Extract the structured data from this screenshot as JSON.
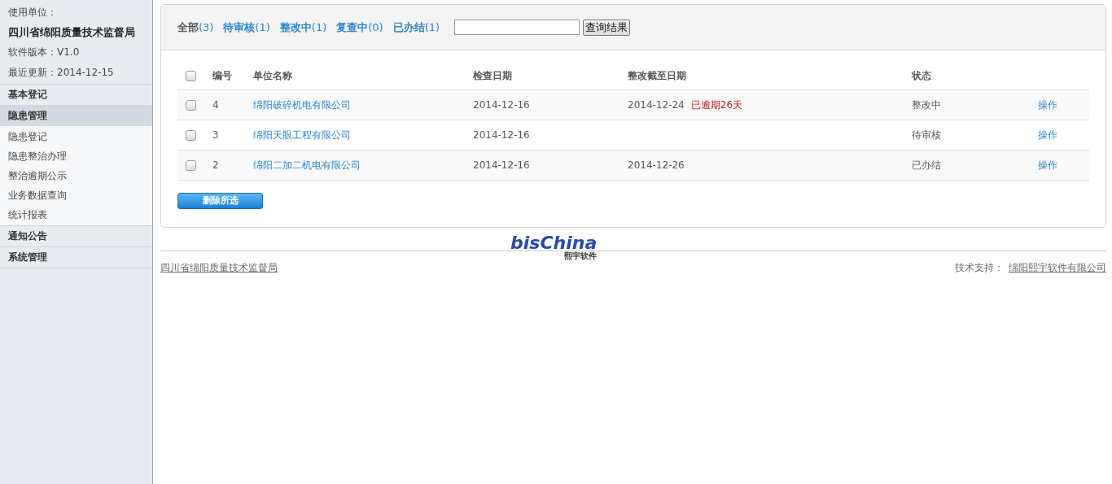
{
  "sidebar": {
    "info": [
      {
        "label": "使用单位：",
        "bold": false
      },
      {
        "label": "四川省绵阳质量技术监督局",
        "bold": true
      },
      {
        "label": "软件版本：V1.0",
        "bold": false
      },
      {
        "label": "最近更新：2014-12-15",
        "bold": false
      }
    ],
    "sections": [
      {
        "label": "基本登记",
        "expanded": false
      },
      {
        "label": "隐患管理",
        "expanded": true,
        "children": [
          {
            "label": "隐患登记"
          },
          {
            "label": "隐患整治办理"
          },
          {
            "label": "整治逾期公示"
          },
          {
            "label": "业务数据查询"
          },
          {
            "label": "统计报表"
          }
        ]
      },
      {
        "label": "通知公告",
        "expanded": false
      },
      {
        "label": "系统管理",
        "expanded": false
      }
    ]
  },
  "filters": [
    {
      "label": "全部",
      "count": "(3)",
      "selected": true
    },
    {
      "label": "待审核",
      "count": "(1)",
      "selected": false
    },
    {
      "label": "整改中",
      "count": "(1)",
      "selected": false
    },
    {
      "label": "复查中",
      "count": "(0)",
      "selected": false
    },
    {
      "label": "已办结",
      "count": "(1)",
      "selected": false
    }
  ],
  "search": {
    "button": "查询结果"
  },
  "table": {
    "all_checked": false,
    "columns": [
      "编号",
      "单位名称",
      "检查日期",
      "整改截至日期",
      "状态"
    ],
    "rows": [
      {
        "checked": false,
        "no": "4",
        "name": "绵阳破碎机电有限公司",
        "check_date": "2014-12-16",
        "deadline": "2014-12-24",
        "overdue": "已逾期26天",
        "status": "整改中",
        "action": "操作"
      },
      {
        "checked": false,
        "no": "3",
        "name": "绵阳天眼工程有限公司",
        "check_date": "2014-12-16",
        "status": "待审核",
        "action": "操作"
      },
      {
        "checked": false,
        "no": "2",
        "name": "绵阳二加二机电有限公司",
        "check_date": "2014-12-16",
        "deadline": "2014-12-26",
        "status": "已办结",
        "action": "操作"
      }
    ]
  },
  "delete_button": "删除所选",
  "footer": {
    "logo": "bisChina",
    "logo_sub": "熙宇软件",
    "left_link": "四川省绵阳质量技术监督局",
    "support_label": "技术支持：",
    "support_link": "绵阳熙宇软件有限公司"
  }
}
